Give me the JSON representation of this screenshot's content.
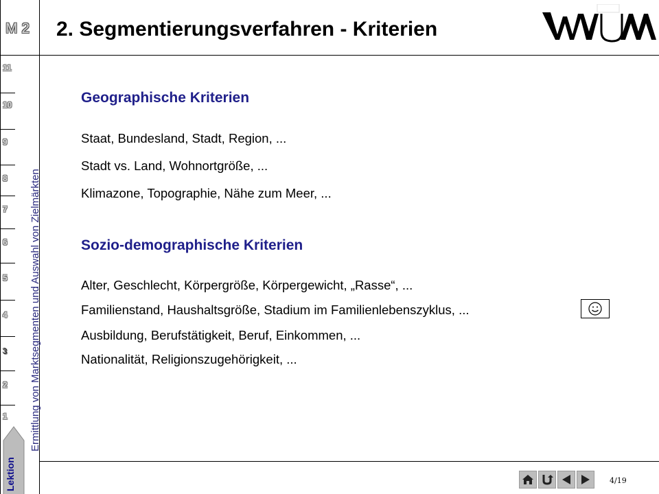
{
  "module": {
    "label": "M 2"
  },
  "page": {
    "title": "2. Segmentierungsverfahren - Kriterien",
    "number": "4/19"
  },
  "sidebar": {
    "section_title": "Ermittlung von Marktsegmenten und Auswahl von Zielmärkten",
    "lessons": [
      "11",
      "10",
      "9",
      "8",
      "7",
      "6",
      "5",
      "4",
      "3",
      "2",
      "1"
    ],
    "active_lesson": "3",
    "tab_label": "Lektion"
  },
  "logo": {
    "text": "WUM"
  },
  "sections": [
    {
      "heading": "Geographische Kriterien",
      "items": [
        "Staat, Bundesland, Stadt, Region, ...",
        "Stadt vs. Land, Wohnortgröße, ...",
        "Klimazone, Topographie, Nähe zum Meer, ..."
      ]
    },
    {
      "heading": "Sozio-demographische Kriterien",
      "items": [
        "Alter, Geschlecht, Körpergröße, Körpergewicht, „Rasse“, ...",
        "Familienstand, Haushaltsgröße, Stadium im Familienlebenszyklus, ...",
        "Ausbildung, Berufstätigkeit, Beruf, Einkommen, ...",
        "Nationalität, Religionszugehörigkeit, ..."
      ]
    }
  ],
  "nav": {
    "buttons": [
      "home-icon",
      "return-icon",
      "previous-icon",
      "next-icon"
    ]
  },
  "colors": {
    "accent": "#1f1f8a",
    "nav": "#bdbdbd"
  }
}
